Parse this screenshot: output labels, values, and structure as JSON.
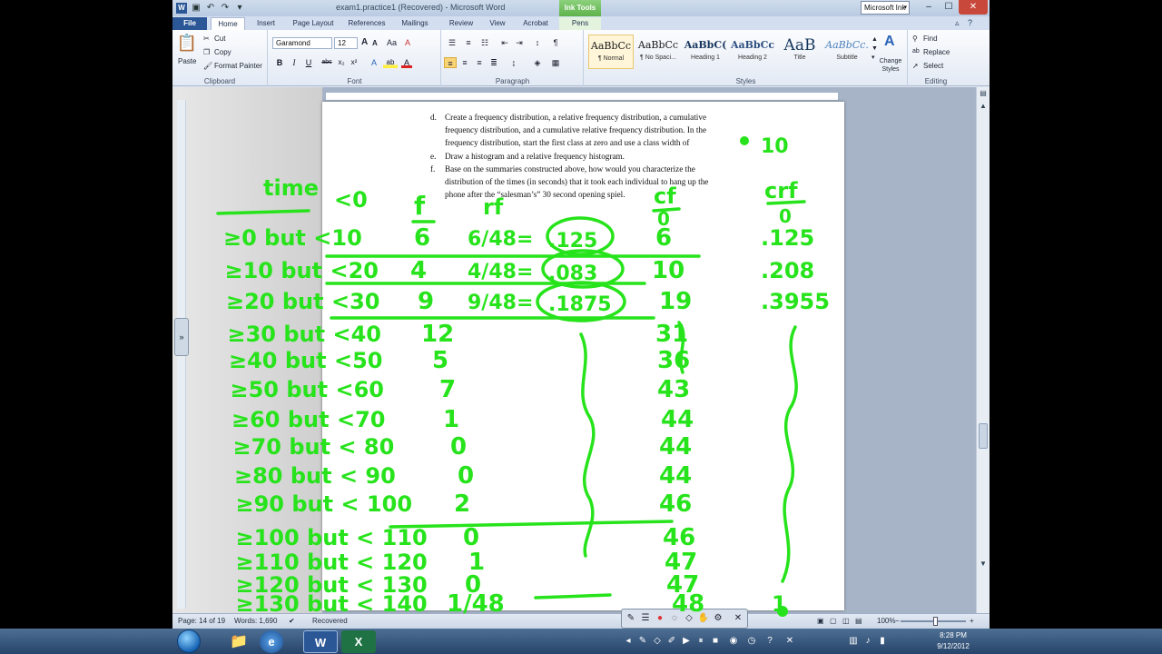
{
  "window": {
    "title": "exam1.practice1 (Recovered) - Microsoft Word",
    "contextual_tab": "Ink Tools",
    "ink_app_button": "Microsoft Ink",
    "controls": {
      "minimize": "–",
      "maximize": "☐",
      "close": "✕"
    }
  },
  "tabs": {
    "file": "File",
    "home": "Home",
    "insert": "Insert",
    "page_layout": "Page Layout",
    "references": "References",
    "mailings": "Mailings",
    "review": "Review",
    "view": "View",
    "acrobat": "Acrobat",
    "pens": "Pens"
  },
  "ribbon": {
    "clipboard": {
      "group": "Clipboard",
      "paste": "Paste",
      "cut": "Cut",
      "copy": "Copy",
      "format_painter": "Format Painter"
    },
    "font": {
      "group": "Font",
      "font_name": "Garamond",
      "font_size": "12",
      "bold": "B",
      "italic": "I",
      "underline": "U",
      "strike": "abc",
      "subscript": "x₂",
      "superscript": "x²",
      "grow": "A",
      "shrink": "A",
      "case": "Aa",
      "clear": "A",
      "highlight": "ab",
      "color": "A"
    },
    "paragraph": {
      "group": "Paragraph"
    },
    "styles": {
      "group": "Styles",
      "items": [
        {
          "sample": "AaBbCc",
          "name": "¶ Normal"
        },
        {
          "sample": "AaBbCc",
          "name": "¶ No Spaci..."
        },
        {
          "sample": "AaBbC(",
          "name": "Heading 1"
        },
        {
          "sample": "AaBbCc",
          "name": "Heading 2"
        },
        {
          "sample": "AaB",
          "name": "Title"
        },
        {
          "sample": "AaBbCc.",
          "name": "Subtitle"
        }
      ],
      "change_styles": "Change Styles"
    },
    "editing": {
      "group": "Editing",
      "find": "Find",
      "replace": "Replace",
      "select": "Select"
    }
  },
  "document": {
    "lines": [
      {
        "marker": "d.",
        "text": "Create a frequency distribution, a relative frequency distribution, a cumulative"
      },
      {
        "marker": "",
        "text": "frequency distribution, and a cumulative relative frequency distribution.  In the"
      },
      {
        "marker": "",
        "text": "frequency distribution, start the first class at zero and use a class width of"
      },
      {
        "marker": "e.",
        "text": "Draw a histogram and a relative frequency histogram."
      },
      {
        "marker": "f.",
        "text": "Base on the summaries constructed above, how would you characterize the"
      },
      {
        "marker": "",
        "text": "distribution of the times (in seconds) that it took each individual to hang up the"
      },
      {
        "marker": "",
        "text": "phone after the “salesman’s” 30 second opening spiel."
      }
    ]
  },
  "ink": {
    "class_width": "10",
    "headers": {
      "time": "time",
      "time_cond": "<0",
      "f": "f",
      "rf": "rf",
      "cf": "cf",
      "crf": "crf",
      "denominator": "0"
    },
    "rows": [
      {
        "cls": "≥0 but <10",
        "f": "6",
        "rf": "6/48=",
        "rf_val": ".125",
        "cf": "6",
        "crf": ".125"
      },
      {
        "cls": "≥10 but <20",
        "f": "4",
        "rf": "4/48=",
        "rf_val": ".083",
        "cf": "10",
        "crf": ".208"
      },
      {
        "cls": "≥20 but <30",
        "f": "9",
        "rf": "9/48=",
        "rf_val": ".1875",
        "cf": "19",
        "crf": ".3955"
      },
      {
        "cls": "≥30 but <40",
        "f": "12",
        "cf": "31"
      },
      {
        "cls": "≥40 but <50",
        "f": "5",
        "cf": "36"
      },
      {
        "cls": "≥50 but <60",
        "f": "7",
        "cf": "43"
      },
      {
        "cls": "≥60 but <70",
        "f": "1",
        "cf": "44"
      },
      {
        "cls": "≥70 but < 80",
        "f": "0",
        "cf": "44"
      },
      {
        "cls": "≥80 but < 90",
        "f": "0",
        "cf": "44"
      },
      {
        "cls": "≥90 but < 100",
        "f": "2",
        "cf": "46"
      },
      {
        "cls": "≥100 but < 110",
        "f": "0",
        "cf": "46"
      },
      {
        "cls": "≥110 but < 120",
        "f": "1",
        "cf": "47"
      },
      {
        "cls": "≥120 but < 130",
        "f": "0",
        "cf": "47"
      },
      {
        "cls": "≥130 but < 140",
        "f": "1/48",
        "cf": "48",
        "crf": "1"
      }
    ]
  },
  "status": {
    "page": "Page: 14 of 19",
    "words": "Words: 1,690",
    "recovered": "Recovered",
    "zoom": "100%"
  },
  "taskbar": {
    "time": "8:28 PM",
    "date": "9/12/2012",
    "apps": [
      {
        "label": "W"
      },
      {
        "label": "X"
      }
    ]
  },
  "colors": {
    "ink": "#27e31b",
    "file_tab": "#2b5797",
    "ink_tools": "#5fb24b"
  }
}
